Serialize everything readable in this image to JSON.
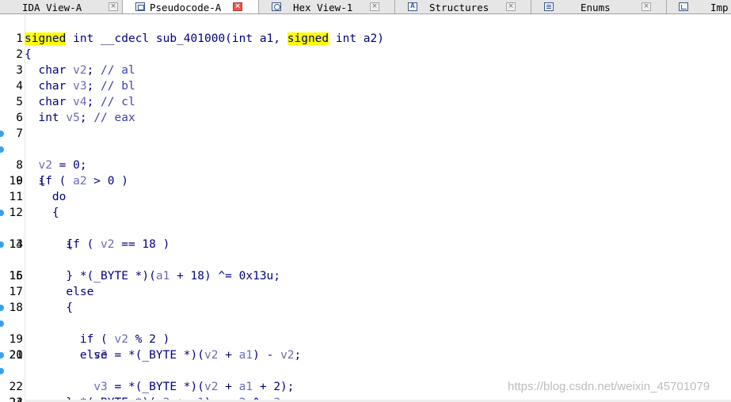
{
  "tabs": [
    {
      "label": "IDA View-A",
      "icon": "ida-view-icon",
      "active": false
    },
    {
      "label": "Pseudocode-A",
      "icon": "pseudocode-icon",
      "active": true
    },
    {
      "label": "Hex View-1",
      "icon": "hex-view-icon",
      "active": false
    },
    {
      "label": "Structures",
      "icon": "structures-icon",
      "active": false
    },
    {
      "label": "Enums",
      "icon": "enums-icon",
      "active": false
    },
    {
      "label": "Imp",
      "icon": "imports-icon",
      "active": false
    }
  ],
  "close_glyph": "×",
  "structures_icon_glyph": "A",
  "code_lines": [
    {
      "num": "1"
    },
    {
      "num": "2"
    },
    {
      "num": "3"
    },
    {
      "num": "4"
    },
    {
      "num": "5"
    },
    {
      "num": "6"
    },
    {
      "num": "7"
    },
    {
      "num": "8"
    },
    {
      "num": "9"
    },
    {
      "num": "10"
    },
    {
      "num": "11"
    },
    {
      "num": "12"
    },
    {
      "num": "13"
    },
    {
      "num": "14"
    },
    {
      "num": "15"
    },
    {
      "num": "16"
    },
    {
      "num": "17"
    },
    {
      "num": "18"
    },
    {
      "num": "19"
    },
    {
      "num": "20"
    },
    {
      "num": "21"
    },
    {
      "num": "22"
    },
    {
      "num": "23"
    },
    {
      "num": "24"
    }
  ],
  "colors": {
    "highlight": "#ffff00",
    "code_text": "#000080",
    "variable": "#6a6ab5",
    "breakpoint": "#3aa0e8",
    "active_close": "#e35a4a"
  },
  "watermark": "https://blog.csdn.net/weixin_45701079"
}
